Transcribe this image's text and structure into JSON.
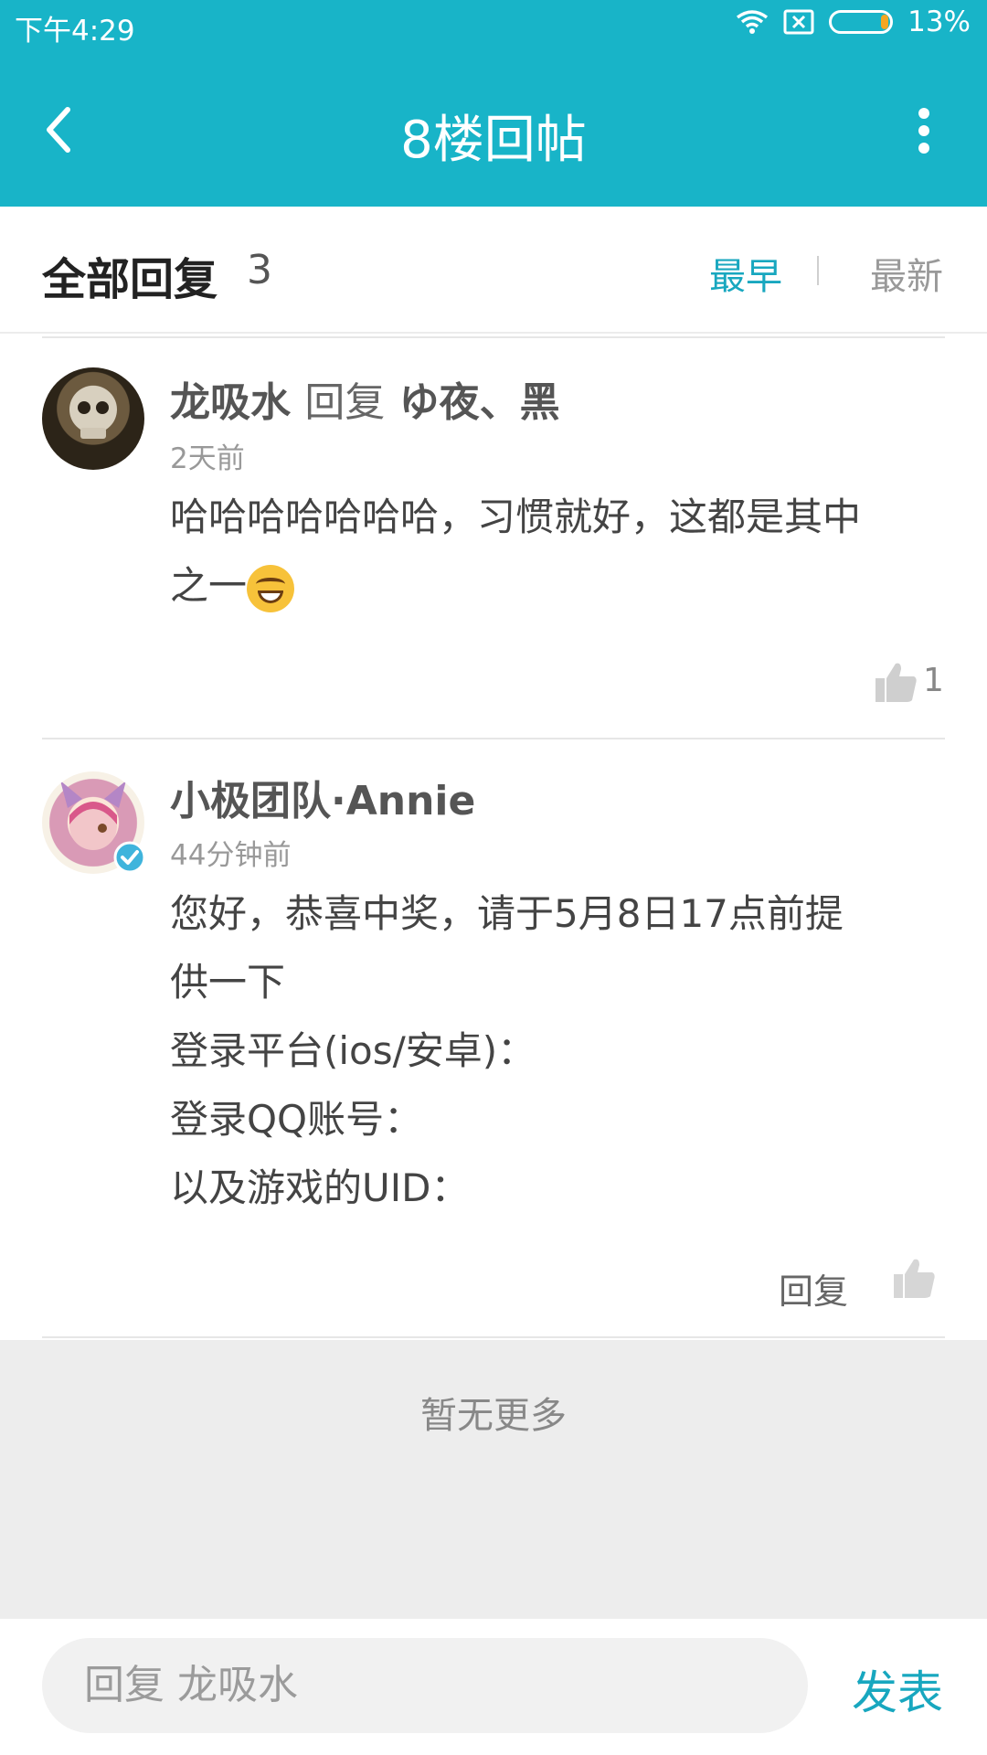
{
  "status_bar": {
    "time": "下午4:29",
    "battery": "13%",
    "battery_level": 0.13
  },
  "header": {
    "title": "8楼回帖"
  },
  "section": {
    "title": "全部回复",
    "count": "3",
    "sort_earliest": "最早",
    "sort_latest": "最新"
  },
  "comments": [
    {
      "author": "龙吸水",
      "reply_word": "回复",
      "reply_to": "ゆ夜、黑",
      "time": "2天前",
      "lines": [
        "哈哈哈哈哈哈哈，习惯就好，这都是其中",
        "之一"
      ],
      "emoji": "grin-emoji",
      "likes": "1"
    },
    {
      "author": "小极团队·Annie",
      "time": "44分钟前",
      "lines": [
        "您好，恭喜中奖，请于5月8日17点前提",
        "供一下",
        "登录平台(ios/安卓)：",
        "登录QQ账号：",
        "以及游戏的UID："
      ],
      "reply_label": "回复"
    }
  ],
  "footer": {
    "no_more": "暂无更多"
  },
  "composer": {
    "placeholder": "回复 龙吸水",
    "send": "发表"
  }
}
